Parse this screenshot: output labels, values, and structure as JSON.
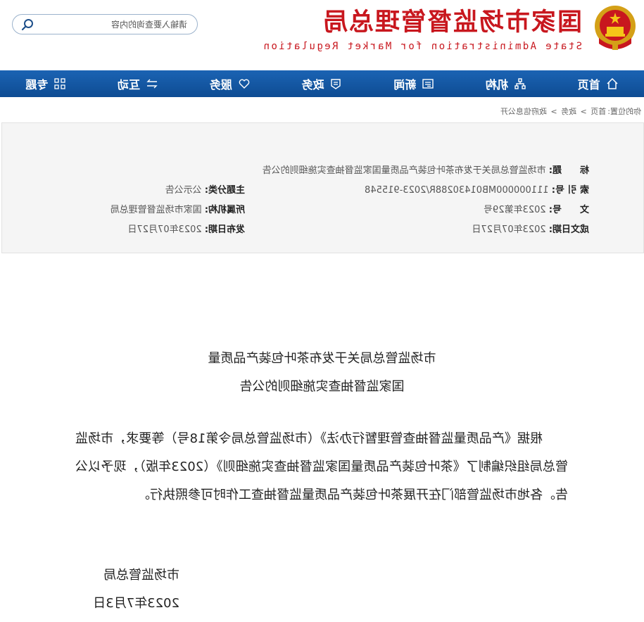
{
  "header": {
    "title_cn": "国家市场监督管理总局",
    "title_en": "State Administration for Market Regulation",
    "search_placeholder": "请输入要查询的内容"
  },
  "nav": [
    {
      "label": "首页",
      "icon": "home-icon"
    },
    {
      "label": "机构",
      "icon": "org-chart-icon"
    },
    {
      "label": "新闻",
      "icon": "newspaper-icon"
    },
    {
      "label": "政务",
      "icon": "document-icon"
    },
    {
      "label": "服务",
      "icon": "heart-icon"
    },
    {
      "label": "互动",
      "icon": "exchange-arrows-icon"
    },
    {
      "label": "专题",
      "icon": "grid-icon"
    }
  ],
  "breadcrumb": {
    "prefix": "你的位置:",
    "items": [
      "首页",
      "政务",
      "政府信息公开"
    ],
    "separator": ">"
  },
  "meta": {
    "title_label": "标　　题:",
    "title_value": "市场监管总局关于发布茶叶包装产品质量国家监督抽查实施细则的公告",
    "index_label": "索 引 号:",
    "index_value": "111000000MB01430288R/2023-915548",
    "topic_label": "主题分类:",
    "topic_value": "公示公告",
    "doc_no_label": "文　　号:",
    "doc_no_value": "2023年第29号",
    "org_label": "所属机构:",
    "org_value": "国家市场监督管理总局",
    "created_label": "成文日期:",
    "created_value": "2023年07月27日",
    "published_label": "发布日期:",
    "published_value": "2023年07月27日"
  },
  "document": {
    "title_line1": "市场监管总局关于发布茶叶包装产品质量",
    "title_line2": "国家监督抽查实施细则的公告",
    "body": "根据《产品质量监督抽查管理暂行办法》（市场监管总局令第18号）等要求，市场监管总局组织编制了《茶叶包装产品质量国家监督抽查实施细则》（2023年版），现予以公告。各地市场监管部门在开展茶叶包装产品质量监督抽查工作时可参照执行。",
    "sign_org": "市场监管总局",
    "sign_date": "2023年7月3日"
  },
  "colors": {
    "brand_red": "#c8171e",
    "nav_blue": "#0e4c93",
    "meta_bg": "#f5f5f5"
  }
}
